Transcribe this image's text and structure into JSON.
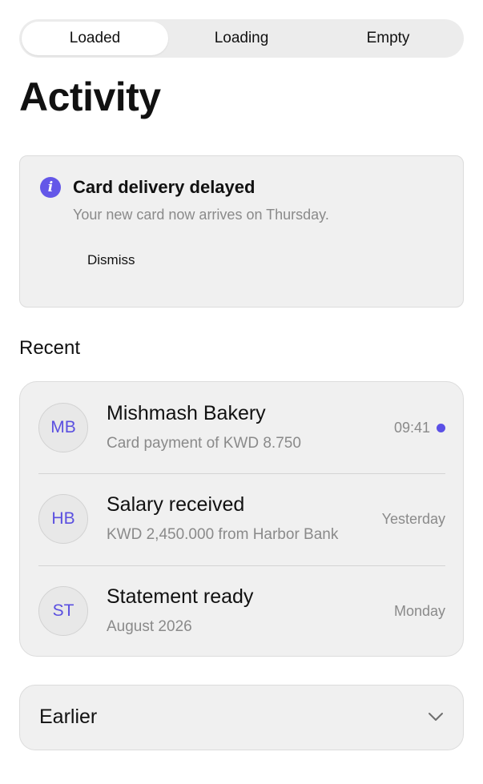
{
  "segmented_control": {
    "options": [
      "Loaded",
      "Loading",
      "Empty"
    ],
    "selected": "Loaded"
  },
  "page_title": "Activity",
  "notice": {
    "icon": "info-icon",
    "title": "Card delivery delayed",
    "body": "Your new card now arrives on Thursday.",
    "dismiss_label": "Dismiss"
  },
  "recent": {
    "heading": "Recent",
    "items": [
      {
        "initials": "MB",
        "title": "Mishmash Bakery",
        "subtitle": "Card payment of KWD 8.750",
        "time": "09:41",
        "unread": true
      },
      {
        "initials": "HB",
        "title": "Salary received",
        "subtitle": "KWD 2,450.000 from Harbor Bank",
        "time": "Yesterday",
        "unread": false
      },
      {
        "initials": "ST",
        "title": "Statement ready",
        "subtitle": "August 2026",
        "time": "Monday",
        "unread": false
      }
    ]
  },
  "earlier": {
    "label": "Earlier",
    "icon": "chevron-down-icon"
  },
  "colors": {
    "accent": "#5b50e6",
    "card_background": "#f0f0f0",
    "secondary_text": "#8a8a8a"
  }
}
